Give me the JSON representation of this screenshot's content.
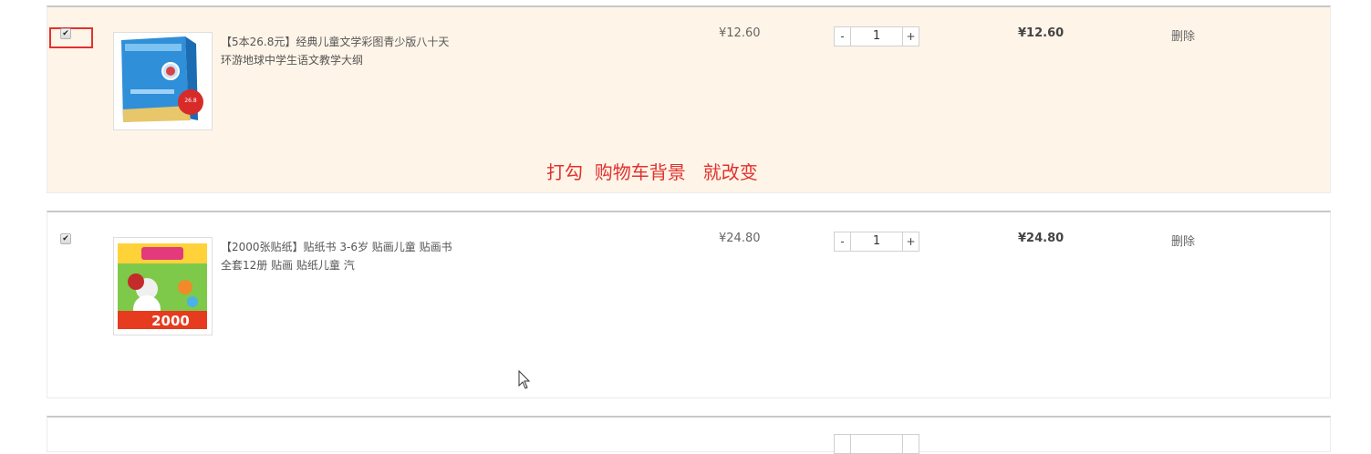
{
  "cart": {
    "items": [
      {
        "checked": true,
        "title": "【5本26.8元】经典儿童文学彩图青少版八十天环游地球中学生语文教学大纲",
        "price": "¥12.60",
        "quantity": "1",
        "subtotal": "¥12.60",
        "delete_label": "删除",
        "thumb_badge": "26.8"
      },
      {
        "checked": true,
        "title": "【2000张贴纸】贴纸书 3-6岁 贴画儿童 贴画书全套12册 贴画 贴纸儿童 汽",
        "price": "¥24.80",
        "quantity": "1",
        "subtotal": "¥24.80",
        "delete_label": "删除",
        "thumb_badge": "2000"
      }
    ],
    "qty_minus": "-",
    "qty_plus": "+",
    "checkbox_glyph": "✔"
  },
  "annotation": {
    "text": "打勾  购物车背景   就改变",
    "color": "#e0322e"
  },
  "colors": {
    "checked_row_bg": "#fff4e8",
    "row_bg": "#ffffff"
  }
}
